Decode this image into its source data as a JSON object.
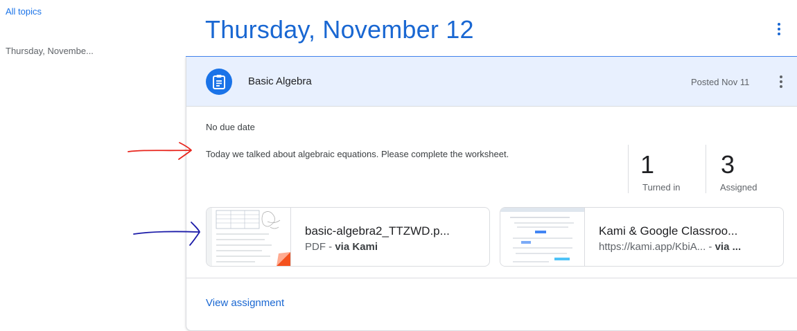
{
  "sidebar": {
    "all_topics": "All topics",
    "topic": "Thursday, Novembe..."
  },
  "topic_header": {
    "title": "Thursday, November 12"
  },
  "assignment": {
    "title": "Basic Algebra",
    "posted": "Posted Nov 11",
    "due": "No due date",
    "description": "Today we talked about algebraic equations.  Please complete the worksheet.",
    "stats": [
      {
        "value": "1",
        "label": "Turned in"
      },
      {
        "value": "3",
        "label": "Assigned"
      }
    ],
    "attachments": [
      {
        "name": "basic-algebra2_TTZWD.p...",
        "type": "PDF",
        "via": "via Kami"
      },
      {
        "name": "Kami & Google Classroo...",
        "type": "https://kami.app/KbiA...",
        "via": "via ..."
      }
    ],
    "view_link": "View assignment"
  },
  "icons": {
    "assignment": "assignment-icon",
    "more": "more-vert-icon"
  },
  "colors": {
    "accent": "#1967d2",
    "header_bg": "#e8f0fe",
    "annotation_red": "#e8251c",
    "annotation_blue": "#1a1aa8",
    "kami_corner": "#f4511e"
  }
}
